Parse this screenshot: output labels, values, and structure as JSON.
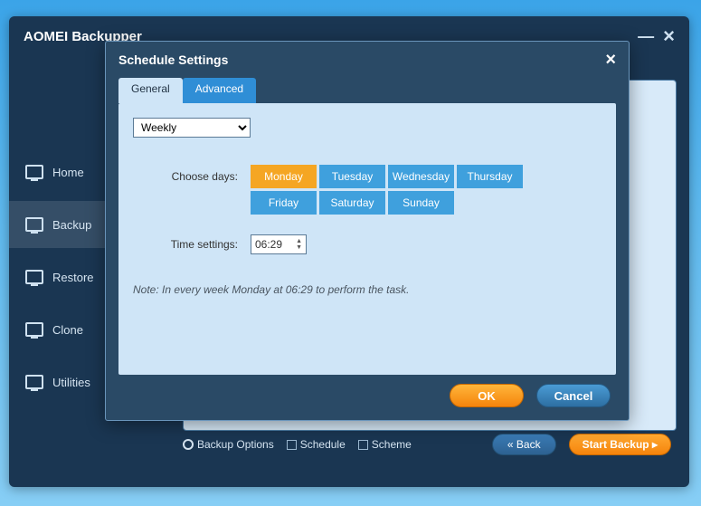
{
  "main": {
    "title": "AOMEI Backupper"
  },
  "sidebar": {
    "items": [
      {
        "label": "Home"
      },
      {
        "label": "Backup"
      },
      {
        "label": "Restore"
      },
      {
        "label": "Clone"
      },
      {
        "label": "Utilities"
      }
    ]
  },
  "footer": {
    "backup_options": "Backup Options",
    "schedule": "Schedule",
    "scheme": "Scheme",
    "back": "«  Back",
    "start": "Start Backup ▸"
  },
  "dialog": {
    "title": "Schedule Settings",
    "tabs": {
      "general": "General",
      "advanced": "Advanced"
    },
    "frequency": "Weekly",
    "choose_days_label": "Choose days:",
    "days": [
      "Monday",
      "Tuesday",
      "Wednesday",
      "Thursday",
      "Friday",
      "Saturday",
      "Sunday"
    ],
    "selected_day": "Monday",
    "time_label": "Time settings:",
    "time_value": "06:29",
    "note": "Note: In every week Monday at 06:29 to perform the task.",
    "ok": "OK",
    "cancel": "Cancel"
  }
}
